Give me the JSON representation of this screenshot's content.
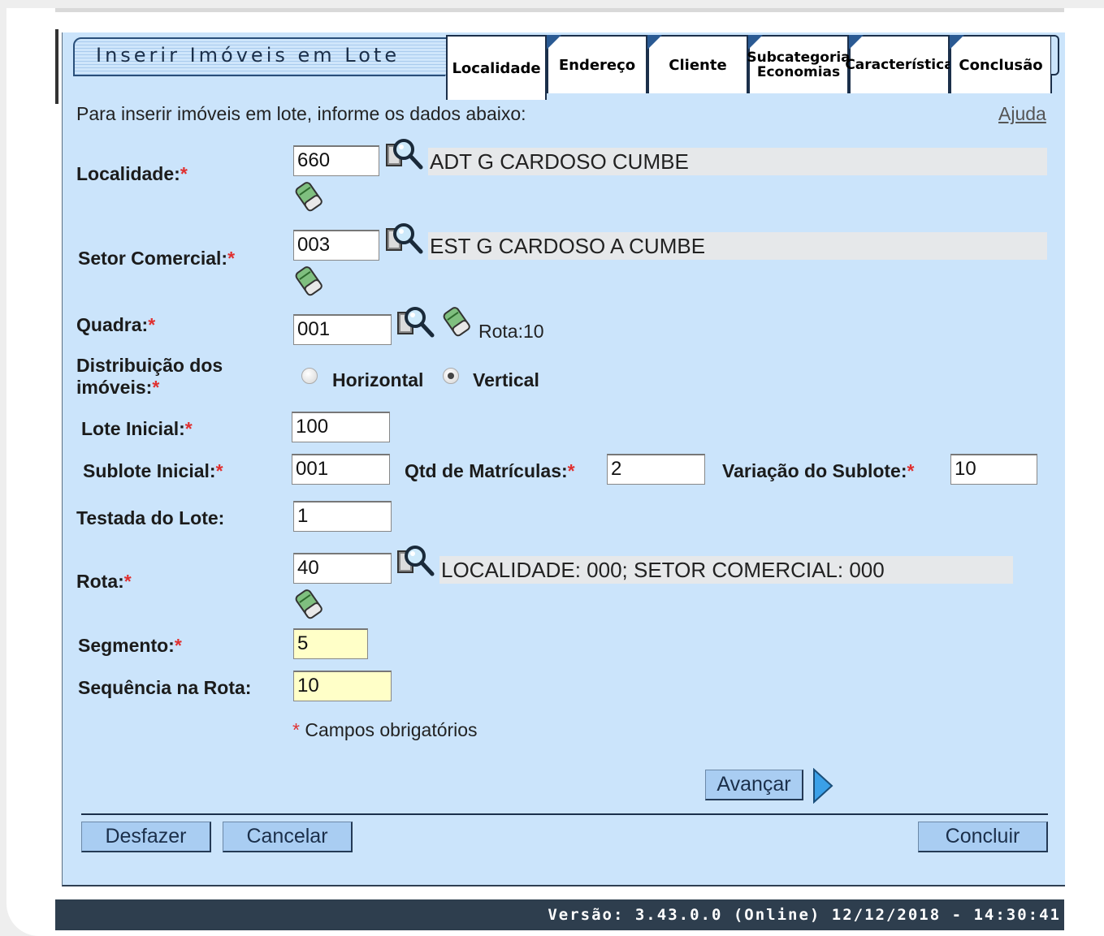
{
  "window": {
    "title": "Inserir Imóveis em Lote"
  },
  "tabs": [
    {
      "label": "Localidade",
      "active": true
    },
    {
      "label": "Endereço"
    },
    {
      "label": "Cliente"
    },
    {
      "label": "Subcategoria Economias"
    },
    {
      "label": "Característica"
    },
    {
      "label": "Conclusão"
    }
  ],
  "intro": "Para inserir imóveis em lote, informe os dados abaixo:",
  "help_link": "Ajuda",
  "required_mark": "*",
  "form": {
    "localidade": {
      "label": "Localidade:",
      "value": "660",
      "description": "ADT G CARDOSO CUMBE"
    },
    "setor_comercial": {
      "label": "Setor Comercial:",
      "value": "003",
      "description": "EST G CARDOSO A CUMBE"
    },
    "quadra": {
      "label": "Quadra:",
      "value": "001",
      "rota_info": "Rota:10"
    },
    "distribuicao": {
      "label_line1": "Distribuição dos",
      "label_line2": "imóveis:",
      "options": [
        "Horizontal",
        "Vertical"
      ],
      "selected": "Vertical"
    },
    "lote_inicial": {
      "label": "Lote Inicial:",
      "value": "100"
    },
    "sublote_inicial": {
      "label": "Sublote Inicial:",
      "value": "001"
    },
    "qtd_matriculas": {
      "label": "Qtd de Matrículas:",
      "value": "2"
    },
    "variacao_sublote": {
      "label": "Variação do Sublote:",
      "value": "10"
    },
    "testada_lote": {
      "label": "Testada do Lote:",
      "value": "1"
    },
    "rota": {
      "label": "Rota:",
      "value": "40",
      "description": "LOCALIDADE: 000; SETOR COMERCIAL: 000"
    },
    "segmento": {
      "label": "Segmento:",
      "value": "5"
    },
    "sequencia_rota": {
      "label": "Sequência na Rota:",
      "value": "10"
    }
  },
  "required_note": "Campos obrigatórios",
  "buttons": {
    "avancar": "Avançar",
    "desfazer": "Desfazer",
    "cancelar": "Cancelar",
    "concluir": "Concluir"
  },
  "footer": {
    "version": "Versão: 3.43.0.0 (Online) 12/12/2018 - 14:30:41"
  },
  "colors": {
    "panel_bg": "#cbe4fb",
    "button_bg": "#a9cdf2",
    "required": "#e03030",
    "highlight_input": "#ffffc8",
    "footer_bg": "#2e3e4e"
  },
  "icons": [
    "magnifier-search-icon",
    "eraser-icon",
    "next-arrow-icon"
  ]
}
